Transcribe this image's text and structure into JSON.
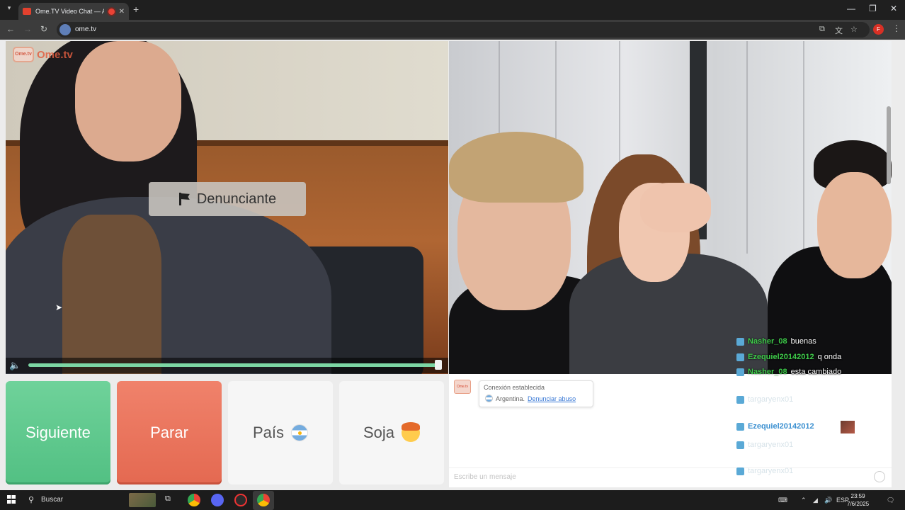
{
  "browser": {
    "tab_title": "Ome.TV Video Chat — Alte",
    "url": "ome.tv",
    "profile_initial": "F"
  },
  "left_video": {
    "logo_text": "Ome.tv",
    "logo_box_text": "Ome.tv",
    "report_label": "Denunciante",
    "volume_level": 1.0
  },
  "controls": {
    "next_label": "Siguiente",
    "stop_label": "Parar",
    "country_label": "País",
    "gender_label": "Soja"
  },
  "chat": {
    "system_line1": "Conexión establecida",
    "system_country": "Argentina.",
    "report_link": "Denunciar abuso",
    "input_placeholder": "Escribe un mensaje"
  },
  "overlay_comments": [
    {
      "name": "Nasher_08",
      "text": "buenas",
      "style": "live"
    },
    {
      "name": "Ezequiel20142012",
      "text": "q onda",
      "style": "live"
    },
    {
      "name": "Nasher_08",
      "text": "esta cambiado",
      "style": "live"
    },
    {
      "name": "targaryenx01",
      "text": "",
      "style": "faded"
    },
    {
      "name": "Ezequiel20142012",
      "text": "",
      "style": "blue"
    },
    {
      "name": "targaryenx01",
      "text": "",
      "style": "faded"
    },
    {
      "name": "targaryenx01",
      "text": "",
      "style": "faded"
    }
  ],
  "taskbar": {
    "search_label": "Buscar",
    "lang": "ESP",
    "time": "23:59",
    "date": "7/6/2025"
  },
  "colors": {
    "next": "#5cc88d",
    "stop": "#e9735c",
    "accent_green": "#7cd6a4"
  }
}
